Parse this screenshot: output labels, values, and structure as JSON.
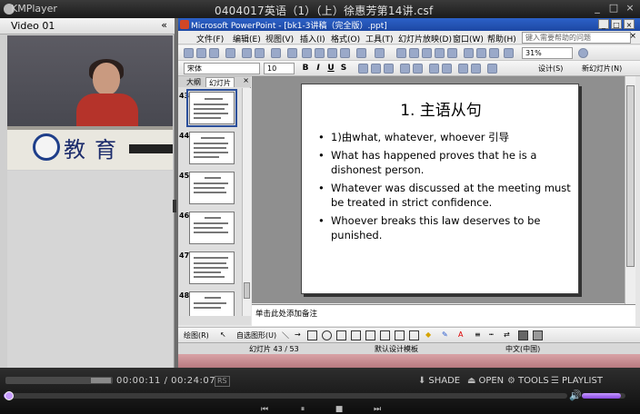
{
  "kmplayer": {
    "app_name": "KMPlayer",
    "file_title": "0404017英语（1）（上）徐惠芳第14讲.csf",
    "window_buttons": [
      "_",
      "□",
      "×"
    ],
    "time_current": "00:00:11",
    "time_total": "00:24:07",
    "time_separator": "/",
    "rs_label": "RS",
    "shade_label": "SHADE",
    "open_label": "OPEN",
    "tools_label": "TOOLS",
    "playlist_label": "PLAYLIST",
    "seek_progress": 0.01,
    "volume_level": 0.9,
    "accent_color": "#9b5cf0"
  },
  "video_panel": {
    "label": "Video 01",
    "collapse_glyph": "«",
    "sign_text": "教育"
  },
  "ppt": {
    "window_title": "Microsoft PowerPoint - [bk1-3讲稿（完全版）.ppt]",
    "menus": [
      "文件(F)",
      "编辑(E)",
      "视图(V)",
      "插入(I)",
      "格式(O)",
      "工具(T)",
      "幻灯片放映(D)",
      "窗口(W)",
      "帮助(H)"
    ],
    "help_placeholder": "键入需要帮助的问题",
    "zoom": "31%",
    "font_name": "宋体",
    "font_size": "10",
    "design_label": "设计(S)",
    "new_slide_label": "新幻灯片(N)",
    "pane_tabs": [
      "大纲",
      "幻灯片"
    ],
    "thumb_numbers": [
      "43",
      "44",
      "45",
      "46",
      "47",
      "48"
    ],
    "selected_thumb": "43",
    "slide_title": "1. 主语从句",
    "bullets": [
      "1)由what, whatever, whoever 引导",
      "What has happened proves that he is a dishonest person.",
      "Whatever was discussed at the meeting must be treated in strict confidence.",
      "Whoever breaks this law deserves to be punished."
    ],
    "notes_placeholder": "单击此处添加备注",
    "draw_label": "绘图(R)",
    "autoshape_label": "自选图形(U)",
    "status_slide": "幻灯片 43 / 53",
    "status_template": "默认设计模板",
    "status_lang": "中文(中国)"
  }
}
